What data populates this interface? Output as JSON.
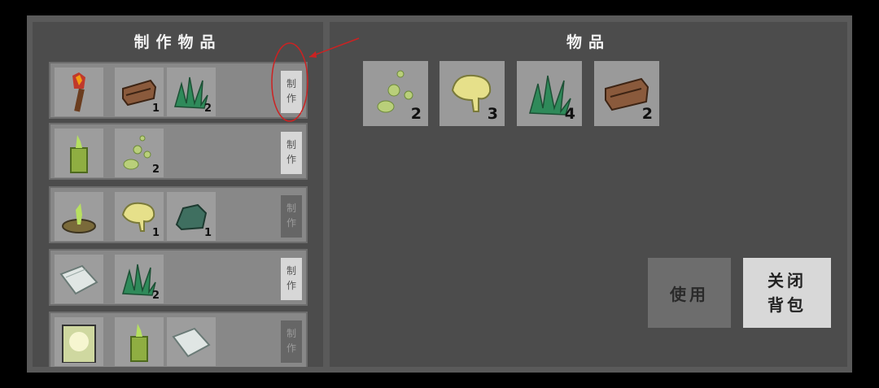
{
  "craft_panel": {
    "title": "制作物品",
    "recipes": [
      {
        "result": "torch-icon",
        "ingredients": [
          {
            "icon": "wood-log-icon",
            "count": "1"
          },
          {
            "icon": "grass-icon",
            "count": "2"
          }
        ],
        "button": "制作",
        "enabled": true
      },
      {
        "result": "green-bottle-icon",
        "ingredients": [
          {
            "icon": "green-seeds-icon",
            "count": "2"
          }
        ],
        "button": "制作",
        "enabled": true
      },
      {
        "result": "plant-pot-icon",
        "ingredients": [
          {
            "icon": "slime-icon",
            "count": "1"
          },
          {
            "icon": "stone-icon",
            "count": "1"
          }
        ],
        "button": "制作",
        "enabled": false
      },
      {
        "result": "paper-icon",
        "ingredients": [
          {
            "icon": "grass-icon",
            "count": "2"
          }
        ],
        "button": "制作",
        "enabled": true
      },
      {
        "result": "glowing-lantern-icon",
        "ingredients": [
          {
            "icon": "green-bottle-icon",
            "count": ""
          },
          {
            "icon": "paper-icon",
            "count": ""
          }
        ],
        "button": "制作",
        "enabled": false
      }
    ]
  },
  "items_panel": {
    "title": "物品",
    "items": [
      {
        "icon": "green-seeds-icon",
        "count": "2"
      },
      {
        "icon": "slime-icon",
        "count": "3"
      },
      {
        "icon": "grass-icon",
        "count": "4"
      },
      {
        "icon": "wood-log-icon",
        "count": "2"
      }
    ]
  },
  "buttons": {
    "use": "使用",
    "close_line1": "关闭",
    "close_line2": "背包"
  },
  "colors": {
    "annotation": "#cc2222",
    "panel": "#4c4c4c",
    "slot": "#9d9d9d"
  }
}
